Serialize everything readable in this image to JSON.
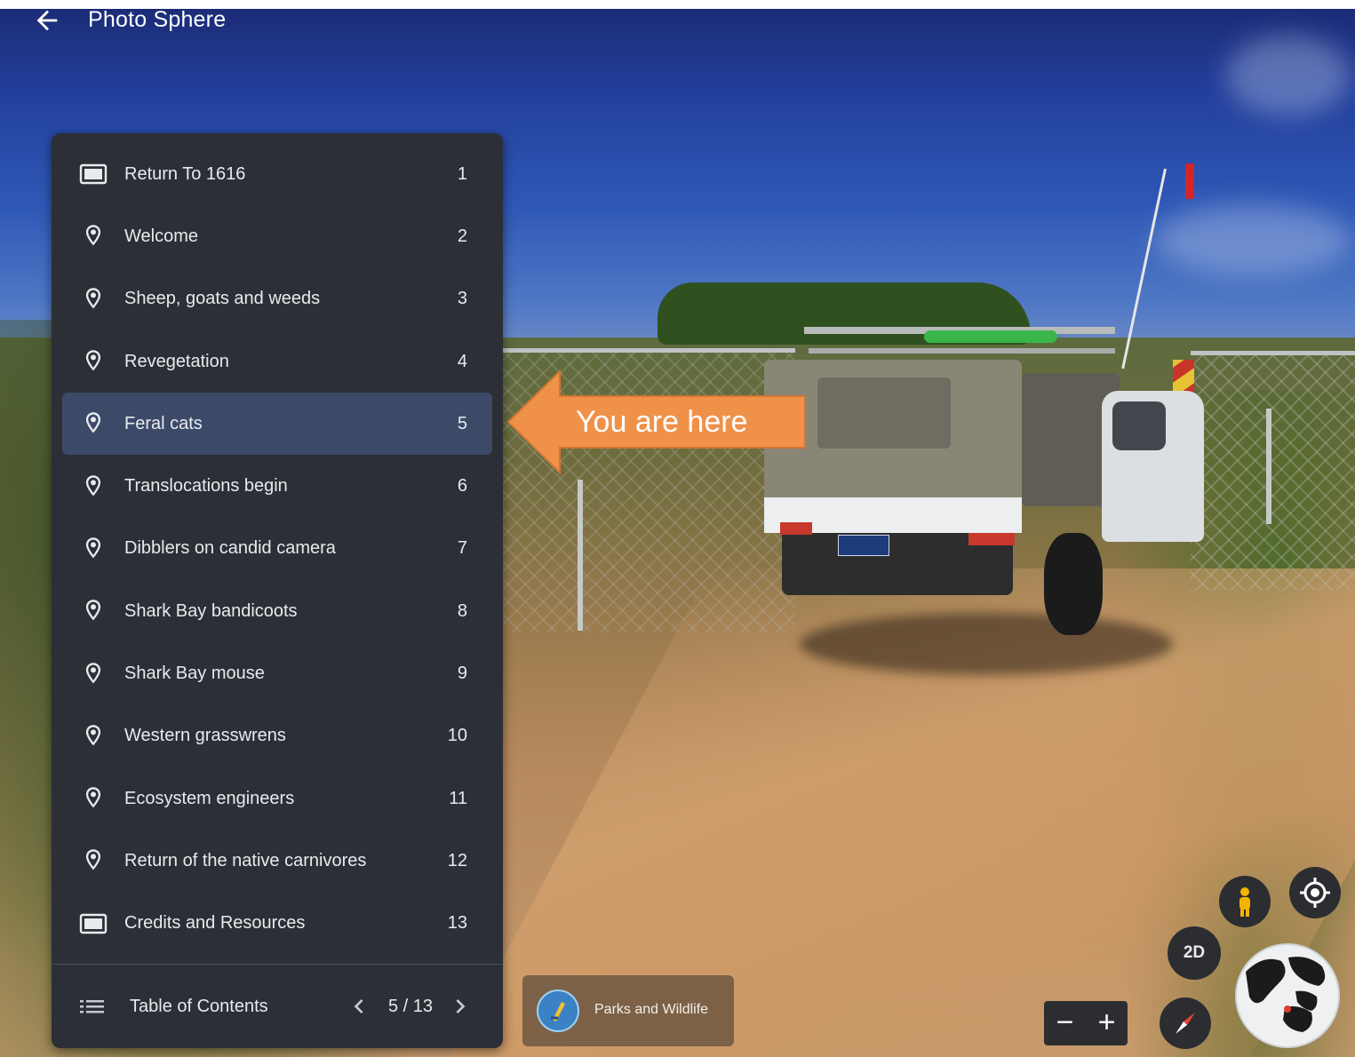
{
  "header": {
    "title": "Photo Sphere",
    "back_icon": "arrow-left-icon"
  },
  "tour": {
    "items": [
      {
        "label": "Return To 1616",
        "number": "1",
        "icon": "slide-icon",
        "active": false
      },
      {
        "label": "Welcome",
        "number": "2",
        "icon": "map-pin-icon",
        "active": false
      },
      {
        "label": "Sheep, goats and weeds",
        "number": "3",
        "icon": "map-pin-icon",
        "active": false
      },
      {
        "label": "Revegetation",
        "number": "4",
        "icon": "map-pin-icon",
        "active": false
      },
      {
        "label": "Feral cats",
        "number": "5",
        "icon": "map-pin-icon",
        "active": true
      },
      {
        "label": "Translocations begin",
        "number": "6",
        "icon": "map-pin-icon",
        "active": false
      },
      {
        "label": "Dibblers on candid camera",
        "number": "7",
        "icon": "map-pin-icon",
        "active": false
      },
      {
        "label": "Shark Bay bandicoots",
        "number": "8",
        "icon": "map-pin-icon",
        "active": false
      },
      {
        "label": "Shark Bay mouse",
        "number": "9",
        "icon": "map-pin-icon",
        "active": false
      },
      {
        "label": "Western grasswrens",
        "number": "10",
        "icon": "map-pin-icon",
        "active": false
      },
      {
        "label": "Ecosystem engineers",
        "number": "11",
        "icon": "map-pin-icon",
        "active": false
      },
      {
        "label": "Return of the native carnivores",
        "number": "12",
        "icon": "map-pin-icon",
        "active": false
      },
      {
        "label": "Credits and Resources",
        "number": "13",
        "icon": "slide-icon",
        "active": false
      }
    ],
    "footer": {
      "label": "Table of Contents",
      "counter": "5 / 13"
    }
  },
  "callout": {
    "text": "You are here",
    "color": "#f0914a"
  },
  "attribution": {
    "label": "Parks and Wildlife"
  },
  "controls": {
    "view_mode": "2D",
    "zoom_out": "−",
    "zoom_in": "+"
  },
  "colors": {
    "panel_bg": "#2c2f36",
    "active_row": "#3c4a68",
    "text": "#e8eaed"
  }
}
